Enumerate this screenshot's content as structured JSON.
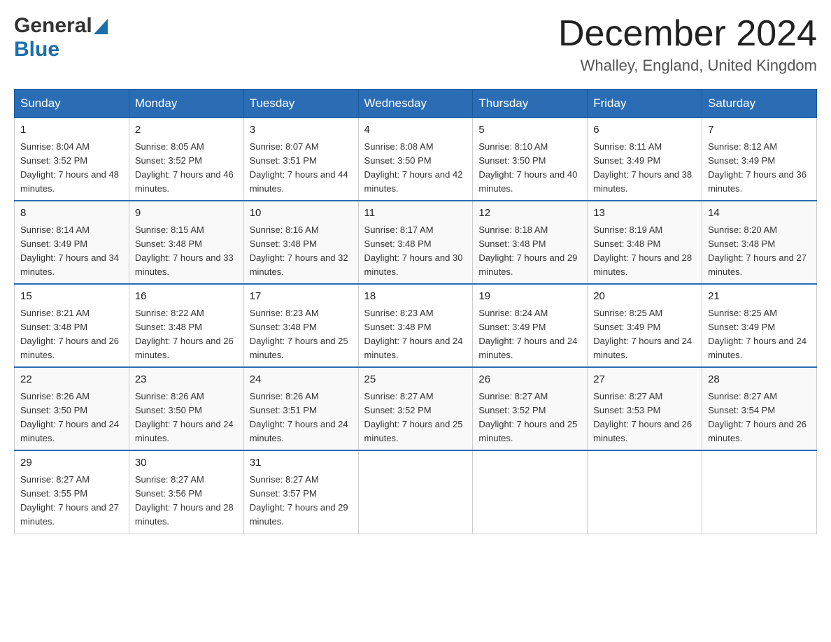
{
  "logo": {
    "general": "General",
    "blue": "Blue",
    "alt": "GeneralBlue logo"
  },
  "header": {
    "title": "December 2024",
    "subtitle": "Whalley, England, United Kingdom"
  },
  "weekdays": [
    "Sunday",
    "Monday",
    "Tuesday",
    "Wednesday",
    "Thursday",
    "Friday",
    "Saturday"
  ],
  "weeks": [
    [
      {
        "day": 1,
        "sunrise": "8:04 AM",
        "sunset": "3:52 PM",
        "daylight": "7 hours and 48 minutes."
      },
      {
        "day": 2,
        "sunrise": "8:05 AM",
        "sunset": "3:52 PM",
        "daylight": "7 hours and 46 minutes."
      },
      {
        "day": 3,
        "sunrise": "8:07 AM",
        "sunset": "3:51 PM",
        "daylight": "7 hours and 44 minutes."
      },
      {
        "day": 4,
        "sunrise": "8:08 AM",
        "sunset": "3:50 PM",
        "daylight": "7 hours and 42 minutes."
      },
      {
        "day": 5,
        "sunrise": "8:10 AM",
        "sunset": "3:50 PM",
        "daylight": "7 hours and 40 minutes."
      },
      {
        "day": 6,
        "sunrise": "8:11 AM",
        "sunset": "3:49 PM",
        "daylight": "7 hours and 38 minutes."
      },
      {
        "day": 7,
        "sunrise": "8:12 AM",
        "sunset": "3:49 PM",
        "daylight": "7 hours and 36 minutes."
      }
    ],
    [
      {
        "day": 8,
        "sunrise": "8:14 AM",
        "sunset": "3:49 PM",
        "daylight": "7 hours and 34 minutes."
      },
      {
        "day": 9,
        "sunrise": "8:15 AM",
        "sunset": "3:48 PM",
        "daylight": "7 hours and 33 minutes."
      },
      {
        "day": 10,
        "sunrise": "8:16 AM",
        "sunset": "3:48 PM",
        "daylight": "7 hours and 32 minutes."
      },
      {
        "day": 11,
        "sunrise": "8:17 AM",
        "sunset": "3:48 PM",
        "daylight": "7 hours and 30 minutes."
      },
      {
        "day": 12,
        "sunrise": "8:18 AM",
        "sunset": "3:48 PM",
        "daylight": "7 hours and 29 minutes."
      },
      {
        "day": 13,
        "sunrise": "8:19 AM",
        "sunset": "3:48 PM",
        "daylight": "7 hours and 28 minutes."
      },
      {
        "day": 14,
        "sunrise": "8:20 AM",
        "sunset": "3:48 PM",
        "daylight": "7 hours and 27 minutes."
      }
    ],
    [
      {
        "day": 15,
        "sunrise": "8:21 AM",
        "sunset": "3:48 PM",
        "daylight": "7 hours and 26 minutes."
      },
      {
        "day": 16,
        "sunrise": "8:22 AM",
        "sunset": "3:48 PM",
        "daylight": "7 hours and 26 minutes."
      },
      {
        "day": 17,
        "sunrise": "8:23 AM",
        "sunset": "3:48 PM",
        "daylight": "7 hours and 25 minutes."
      },
      {
        "day": 18,
        "sunrise": "8:23 AM",
        "sunset": "3:48 PM",
        "daylight": "7 hours and 24 minutes."
      },
      {
        "day": 19,
        "sunrise": "8:24 AM",
        "sunset": "3:49 PM",
        "daylight": "7 hours and 24 minutes."
      },
      {
        "day": 20,
        "sunrise": "8:25 AM",
        "sunset": "3:49 PM",
        "daylight": "7 hours and 24 minutes."
      },
      {
        "day": 21,
        "sunrise": "8:25 AM",
        "sunset": "3:49 PM",
        "daylight": "7 hours and 24 minutes."
      }
    ],
    [
      {
        "day": 22,
        "sunrise": "8:26 AM",
        "sunset": "3:50 PM",
        "daylight": "7 hours and 24 minutes."
      },
      {
        "day": 23,
        "sunrise": "8:26 AM",
        "sunset": "3:50 PM",
        "daylight": "7 hours and 24 minutes."
      },
      {
        "day": 24,
        "sunrise": "8:26 AM",
        "sunset": "3:51 PM",
        "daylight": "7 hours and 24 minutes."
      },
      {
        "day": 25,
        "sunrise": "8:27 AM",
        "sunset": "3:52 PM",
        "daylight": "7 hours and 25 minutes."
      },
      {
        "day": 26,
        "sunrise": "8:27 AM",
        "sunset": "3:52 PM",
        "daylight": "7 hours and 25 minutes."
      },
      {
        "day": 27,
        "sunrise": "8:27 AM",
        "sunset": "3:53 PM",
        "daylight": "7 hours and 26 minutes."
      },
      {
        "day": 28,
        "sunrise": "8:27 AM",
        "sunset": "3:54 PM",
        "daylight": "7 hours and 26 minutes."
      }
    ],
    [
      {
        "day": 29,
        "sunrise": "8:27 AM",
        "sunset": "3:55 PM",
        "daylight": "7 hours and 27 minutes."
      },
      {
        "day": 30,
        "sunrise": "8:27 AM",
        "sunset": "3:56 PM",
        "daylight": "7 hours and 28 minutes."
      },
      {
        "day": 31,
        "sunrise": "8:27 AM",
        "sunset": "3:57 PM",
        "daylight": "7 hours and 29 minutes."
      },
      null,
      null,
      null,
      null
    ]
  ],
  "colors": {
    "header_bg": "#2a6db5",
    "header_text": "#ffffff",
    "border": "#999999",
    "cell_border": "#cccccc"
  }
}
